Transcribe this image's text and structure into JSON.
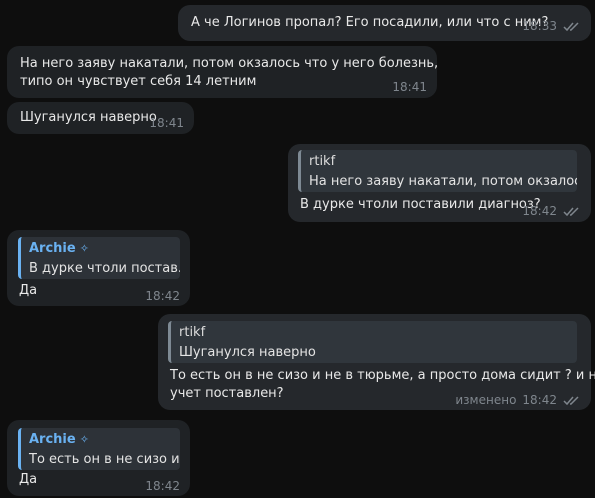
{
  "messages": [
    {
      "text": "А че Логинов пропал? Его посадили, или что с ним?",
      "time": "18:33",
      "direction": "outgoing",
      "read": true
    },
    {
      "text_lines": [
        "На него заяву накатали, потом окзалось что у него болезнь,",
        "типо он чувствует себя 14 летним"
      ],
      "time": "18:41",
      "direction": "incoming"
    },
    {
      "text": "Шуганулся наверно",
      "time": "18:41",
      "direction": "incoming"
    },
    {
      "reply": {
        "author": "rtikf",
        "text": "На него заяву накатали, потом окзалось..."
      },
      "text": "В дурке чтоли поставили диагноз?",
      "time": "18:42",
      "direction": "outgoing",
      "read": true
    },
    {
      "reply": {
        "author": "Archie",
        "text": "В дурке чтоли постав..."
      },
      "text": "Да",
      "time": "18:42",
      "direction": "incoming"
    },
    {
      "reply": {
        "author": "rtikf",
        "text": "Шуганулся наверно"
      },
      "text_lines": [
        "То есть он в не сизо и не в тюрьме, а просто дома сидит ? и на",
        "учет поставлен?"
      ],
      "edited_label": "изменено",
      "time": "18:42",
      "direction": "outgoing",
      "read": true
    },
    {
      "reply": {
        "author": "Archie",
        "text": "То есть он в не сизо и..."
      },
      "text": "Да",
      "time": "18:42",
      "direction": "incoming"
    }
  ],
  "icons": {
    "read_check": "double-check-icon",
    "premium_star": "sparkle-star-icon"
  },
  "colors": {
    "background": "#0e0e0e",
    "incoming_bubble": "#1f2225",
    "outgoing_bubble": "#25282c",
    "reply_accent": "#6ab2f2",
    "meta_text": "#7f868d"
  }
}
